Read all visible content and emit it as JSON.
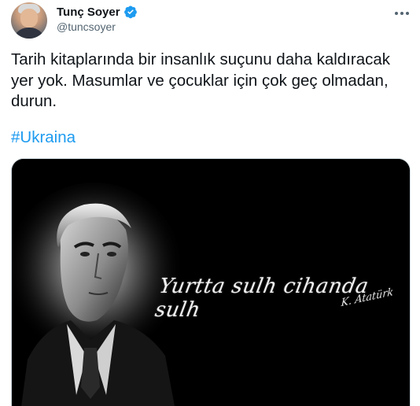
{
  "author": {
    "display_name": "Tunç Soyer",
    "handle": "@tuncsoyer",
    "verified": true
  },
  "icons": {
    "avatar": "profile-photo",
    "verified": "verified-badge-icon",
    "more": "more-options-icon"
  },
  "tweet": {
    "text": "Tarih kitaplarında bir insanlık suçunu daha kaldıracak\nyer yok. Masumlar ve çocuklar için çok geç olmadan,\ndurun.",
    "hashtag": "#Ukraina"
  },
  "media": {
    "quote_text": "Yurtta sulh cihanda sulh",
    "signature": "K. Atatürk"
  },
  "colors": {
    "text": "#0f1419",
    "secondary": "#536471",
    "link": "#1d9bf0",
    "verified": "#1d9bf0",
    "media_bg": "#000000"
  }
}
